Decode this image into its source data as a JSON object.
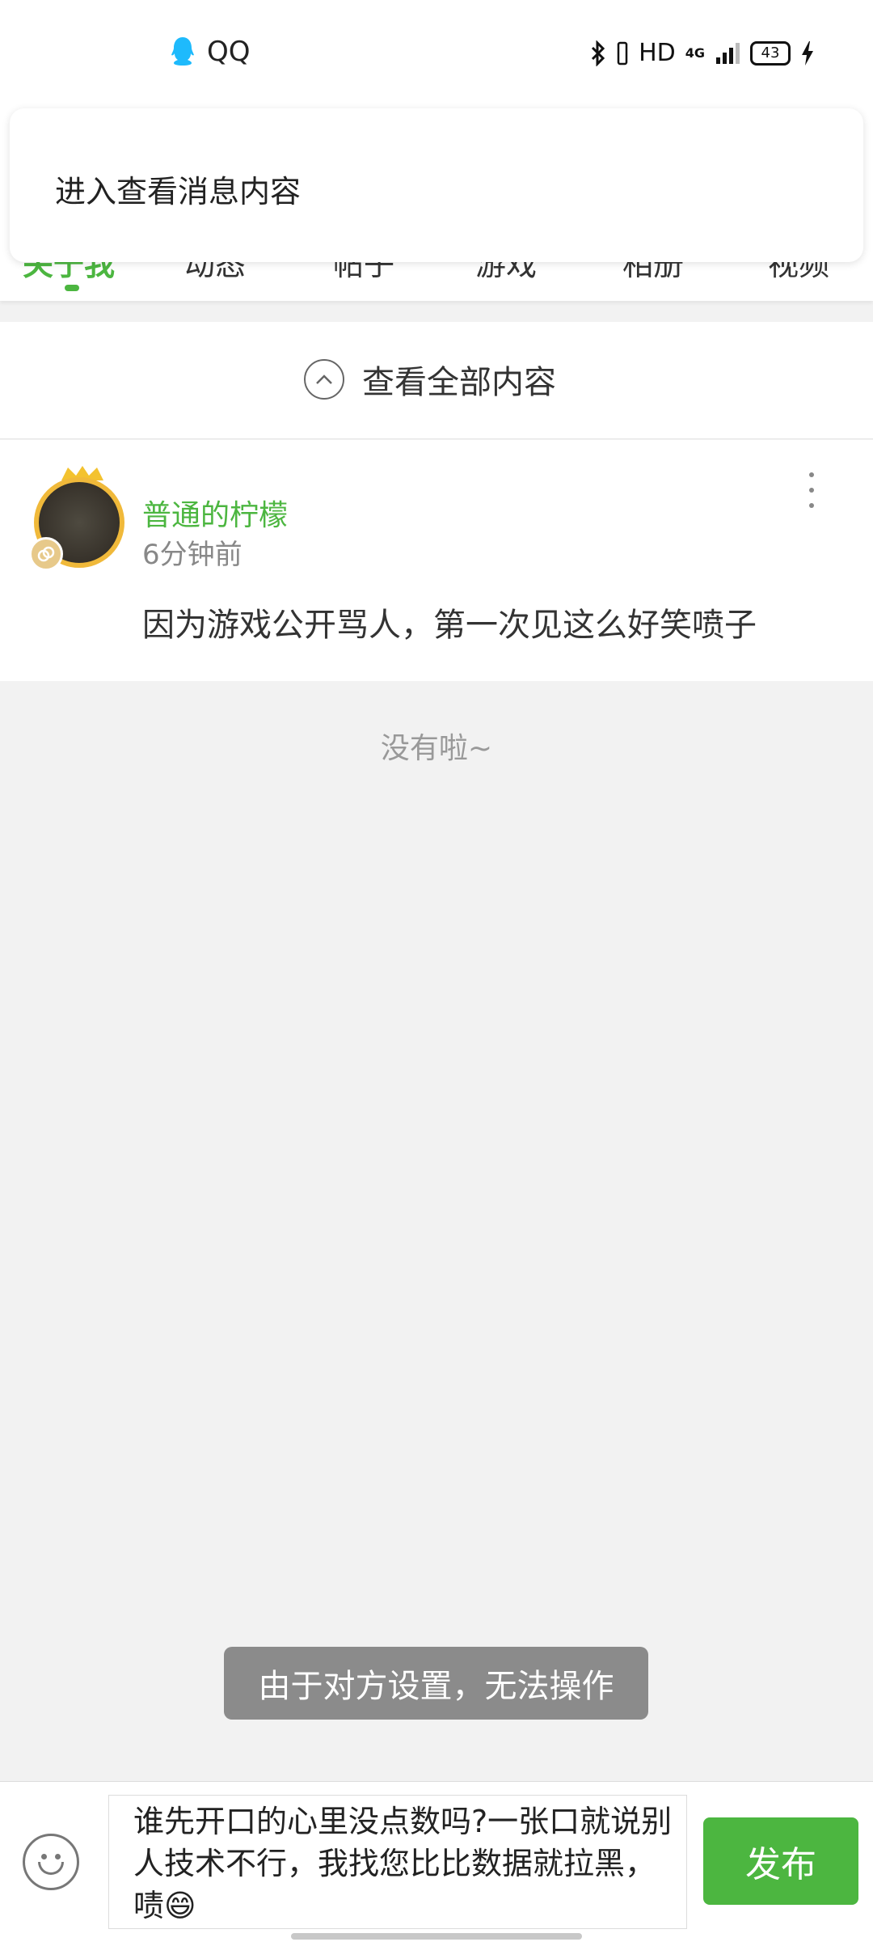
{
  "status_bar": {
    "app_name": "QQ",
    "network_label": "HD",
    "signal_label": "4G",
    "battery": "43"
  },
  "notification": {
    "text": "进入查看消息内容"
  },
  "tabs": [
    {
      "label": "关于我",
      "active": true
    },
    {
      "label": "动态"
    },
    {
      "label": "帖子"
    },
    {
      "label": "游戏"
    },
    {
      "label": "相册"
    },
    {
      "label": "视频"
    }
  ],
  "view_all": {
    "label": "查看全部内容"
  },
  "post": {
    "username": "普通的柠檬",
    "time": "6分钟前",
    "text": "因为游戏公开骂人，第一次见这么好笑喷子"
  },
  "feed_end": "没有啦~",
  "toast": "由于对方设置，无法操作",
  "composer": {
    "text": "谁先开口的心里没点数吗?一张口就说别人技术不行，我找您比比数据就拉黑，啧😄",
    "publish_label": "发布"
  },
  "colors": {
    "accent": "#4cb640",
    "background": "#f2f2f2"
  }
}
